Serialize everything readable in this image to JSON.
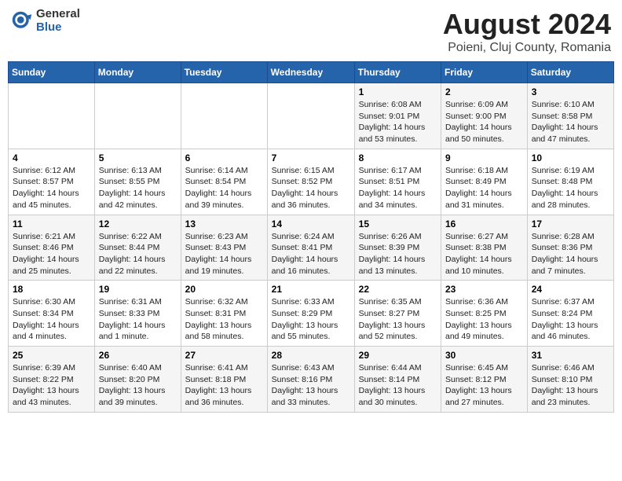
{
  "logo": {
    "general": "General",
    "blue": "Blue"
  },
  "title": "August 2024",
  "subtitle": "Poieni, Cluj County, Romania",
  "days_of_week": [
    "Sunday",
    "Monday",
    "Tuesday",
    "Wednesday",
    "Thursday",
    "Friday",
    "Saturday"
  ],
  "weeks": [
    [
      {
        "day": "",
        "info": ""
      },
      {
        "day": "",
        "info": ""
      },
      {
        "day": "",
        "info": ""
      },
      {
        "day": "",
        "info": ""
      },
      {
        "day": "1",
        "info": "Sunrise: 6:08 AM\nSunset: 9:01 PM\nDaylight: 14 hours and 53 minutes."
      },
      {
        "day": "2",
        "info": "Sunrise: 6:09 AM\nSunset: 9:00 PM\nDaylight: 14 hours and 50 minutes."
      },
      {
        "day": "3",
        "info": "Sunrise: 6:10 AM\nSunset: 8:58 PM\nDaylight: 14 hours and 47 minutes."
      }
    ],
    [
      {
        "day": "4",
        "info": "Sunrise: 6:12 AM\nSunset: 8:57 PM\nDaylight: 14 hours and 45 minutes."
      },
      {
        "day": "5",
        "info": "Sunrise: 6:13 AM\nSunset: 8:55 PM\nDaylight: 14 hours and 42 minutes."
      },
      {
        "day": "6",
        "info": "Sunrise: 6:14 AM\nSunset: 8:54 PM\nDaylight: 14 hours and 39 minutes."
      },
      {
        "day": "7",
        "info": "Sunrise: 6:15 AM\nSunset: 8:52 PM\nDaylight: 14 hours and 36 minutes."
      },
      {
        "day": "8",
        "info": "Sunrise: 6:17 AM\nSunset: 8:51 PM\nDaylight: 14 hours and 34 minutes."
      },
      {
        "day": "9",
        "info": "Sunrise: 6:18 AM\nSunset: 8:49 PM\nDaylight: 14 hours and 31 minutes."
      },
      {
        "day": "10",
        "info": "Sunrise: 6:19 AM\nSunset: 8:48 PM\nDaylight: 14 hours and 28 minutes."
      }
    ],
    [
      {
        "day": "11",
        "info": "Sunrise: 6:21 AM\nSunset: 8:46 PM\nDaylight: 14 hours and 25 minutes."
      },
      {
        "day": "12",
        "info": "Sunrise: 6:22 AM\nSunset: 8:44 PM\nDaylight: 14 hours and 22 minutes."
      },
      {
        "day": "13",
        "info": "Sunrise: 6:23 AM\nSunset: 8:43 PM\nDaylight: 14 hours and 19 minutes."
      },
      {
        "day": "14",
        "info": "Sunrise: 6:24 AM\nSunset: 8:41 PM\nDaylight: 14 hours and 16 minutes."
      },
      {
        "day": "15",
        "info": "Sunrise: 6:26 AM\nSunset: 8:39 PM\nDaylight: 14 hours and 13 minutes."
      },
      {
        "day": "16",
        "info": "Sunrise: 6:27 AM\nSunset: 8:38 PM\nDaylight: 14 hours and 10 minutes."
      },
      {
        "day": "17",
        "info": "Sunrise: 6:28 AM\nSunset: 8:36 PM\nDaylight: 14 hours and 7 minutes."
      }
    ],
    [
      {
        "day": "18",
        "info": "Sunrise: 6:30 AM\nSunset: 8:34 PM\nDaylight: 14 hours and 4 minutes."
      },
      {
        "day": "19",
        "info": "Sunrise: 6:31 AM\nSunset: 8:33 PM\nDaylight: 14 hours and 1 minute."
      },
      {
        "day": "20",
        "info": "Sunrise: 6:32 AM\nSunset: 8:31 PM\nDaylight: 13 hours and 58 minutes."
      },
      {
        "day": "21",
        "info": "Sunrise: 6:33 AM\nSunset: 8:29 PM\nDaylight: 13 hours and 55 minutes."
      },
      {
        "day": "22",
        "info": "Sunrise: 6:35 AM\nSunset: 8:27 PM\nDaylight: 13 hours and 52 minutes."
      },
      {
        "day": "23",
        "info": "Sunrise: 6:36 AM\nSunset: 8:25 PM\nDaylight: 13 hours and 49 minutes."
      },
      {
        "day": "24",
        "info": "Sunrise: 6:37 AM\nSunset: 8:24 PM\nDaylight: 13 hours and 46 minutes."
      }
    ],
    [
      {
        "day": "25",
        "info": "Sunrise: 6:39 AM\nSunset: 8:22 PM\nDaylight: 13 hours and 43 minutes."
      },
      {
        "day": "26",
        "info": "Sunrise: 6:40 AM\nSunset: 8:20 PM\nDaylight: 13 hours and 39 minutes."
      },
      {
        "day": "27",
        "info": "Sunrise: 6:41 AM\nSunset: 8:18 PM\nDaylight: 13 hours and 36 minutes."
      },
      {
        "day": "28",
        "info": "Sunrise: 6:43 AM\nSunset: 8:16 PM\nDaylight: 13 hours and 33 minutes."
      },
      {
        "day": "29",
        "info": "Sunrise: 6:44 AM\nSunset: 8:14 PM\nDaylight: 13 hours and 30 minutes."
      },
      {
        "day": "30",
        "info": "Sunrise: 6:45 AM\nSunset: 8:12 PM\nDaylight: 13 hours and 27 minutes."
      },
      {
        "day": "31",
        "info": "Sunrise: 6:46 AM\nSunset: 8:10 PM\nDaylight: 13 hours and 23 minutes."
      }
    ]
  ]
}
